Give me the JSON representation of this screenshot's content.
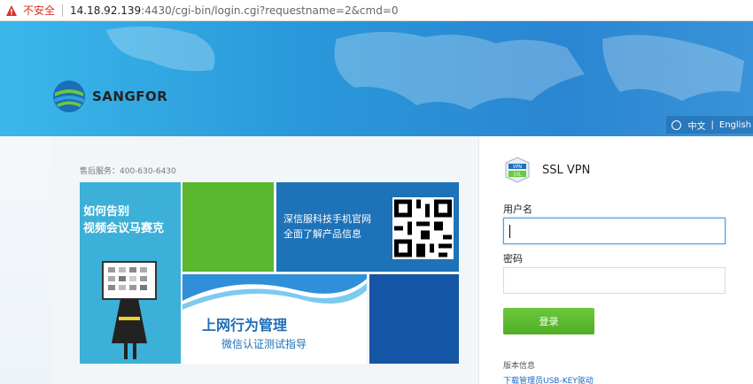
{
  "address_bar": {
    "security_label": "不安全",
    "host": "14.18.92.139",
    "path": ":4430/cgi-bin/login.cgi?requestname=2&cmd=0"
  },
  "brand": {
    "name": "SANGFOR"
  },
  "language": {
    "chinese": "中文",
    "separator": "|",
    "english": "English"
  },
  "service": {
    "label": "售后服务：400-630-6430"
  },
  "tiles": {
    "tile1_line1": "如何告别",
    "tile1_line2": "视频会议马赛克",
    "tile3_line1": "深信服科技手机官网",
    "tile3_line2": "全面了解产品信息",
    "tile4_line1": "上网行为管理",
    "tile4_line2": "微信认证测试指导"
  },
  "login": {
    "title": "SSL VPN",
    "vpn_badge_top": "VPN",
    "vpn_badge_bottom": "SSL",
    "username_label": "用户名",
    "username_value": "",
    "password_label": "密码",
    "password_value": "",
    "login_button": "登录",
    "version_info": "版本信息",
    "download_link": "下载管理员USB-KEY驱动"
  },
  "colors": {
    "banner": "#2a98da",
    "login_button": "#5bb72d",
    "link": "#1d67c2",
    "insecure": "#d93025"
  }
}
